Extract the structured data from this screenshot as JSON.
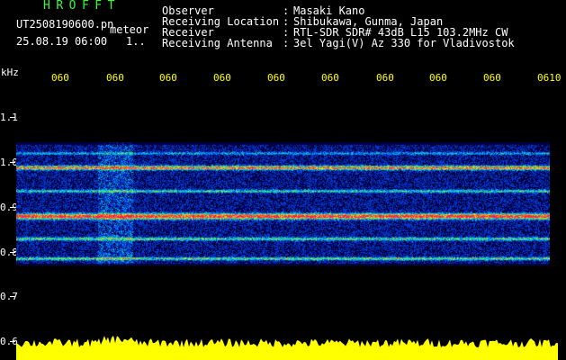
{
  "header": {
    "app_title": "HROFFT",
    "file_name": "UT2508190600.pn",
    "mode": "meteor",
    "date_time": "25.08.19 06:00",
    "counter": "1.."
  },
  "meta": [
    {
      "key": "Observer",
      "value": "Masaki Kano"
    },
    {
      "key": "Receiving Location",
      "value": "Shibukawa, Gunma, Japan"
    },
    {
      "key": "Receiver",
      "value": "RTL-SDR SDR# 43dB L15 103.2MHz CW"
    },
    {
      "key": "Receiving Antenna",
      "value": "3el Yagi(V) Az 330 for Vladivostok"
    }
  ],
  "axis": {
    "unit": "kHz",
    "y_ticks": [
      "1.1",
      "1.0",
      "0.9",
      "0.8",
      "0.7",
      "0.6"
    ],
    "x_ticks": [
      "060",
      "060",
      "060",
      "060",
      "060",
      "060",
      "060",
      "060",
      "060",
      "0610"
    ]
  },
  "colors": {
    "background": "#000000",
    "text": "#ffffff",
    "accent": "#ffff00",
    "title": "#33ff33"
  }
}
